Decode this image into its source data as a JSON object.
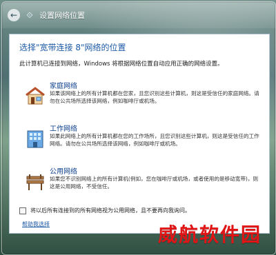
{
  "window": {
    "title": "设置网络位置",
    "back_glyph": "←",
    "network_glyph": "⟐"
  },
  "main": {
    "heading": "选择\"宽带连接 8\"网络的位置",
    "description": "此计算机已连接到网络，Windows 将根据网络位置自动应用正确的网络设置。"
  },
  "options": [
    {
      "title": "家庭网络",
      "text": "如果该网络上的所有计算机都在您家，且您识别这些计算机，则这是受信任的家庭网络。请勿在公共场所选择该网络，例如咖啡厅或机场。"
    },
    {
      "title": "工作网络",
      "text": "如果此网络上的所有计算机都在您的工作场所，且您识别这些计算机，则这是受信任的工作网络。请勿在公共场所选择该网络，例如咖啡厅或机场。"
    },
    {
      "title": "公用网络",
      "text": "如果您不识别网络上的所有计算机(例如，您在咖啡厅或机场，或者使用的是移动宽带)，则这是公用网络，不受信任。"
    }
  ],
  "footer": {
    "checkbox_label": "将以后所有连接到的所有网络视为公用网络，且不要再向我询问。",
    "help_link": "帮助我选择"
  },
  "watermark": "威航软件园",
  "colors": {
    "accent": "#1d5aa6",
    "watermark": "#e11515"
  }
}
